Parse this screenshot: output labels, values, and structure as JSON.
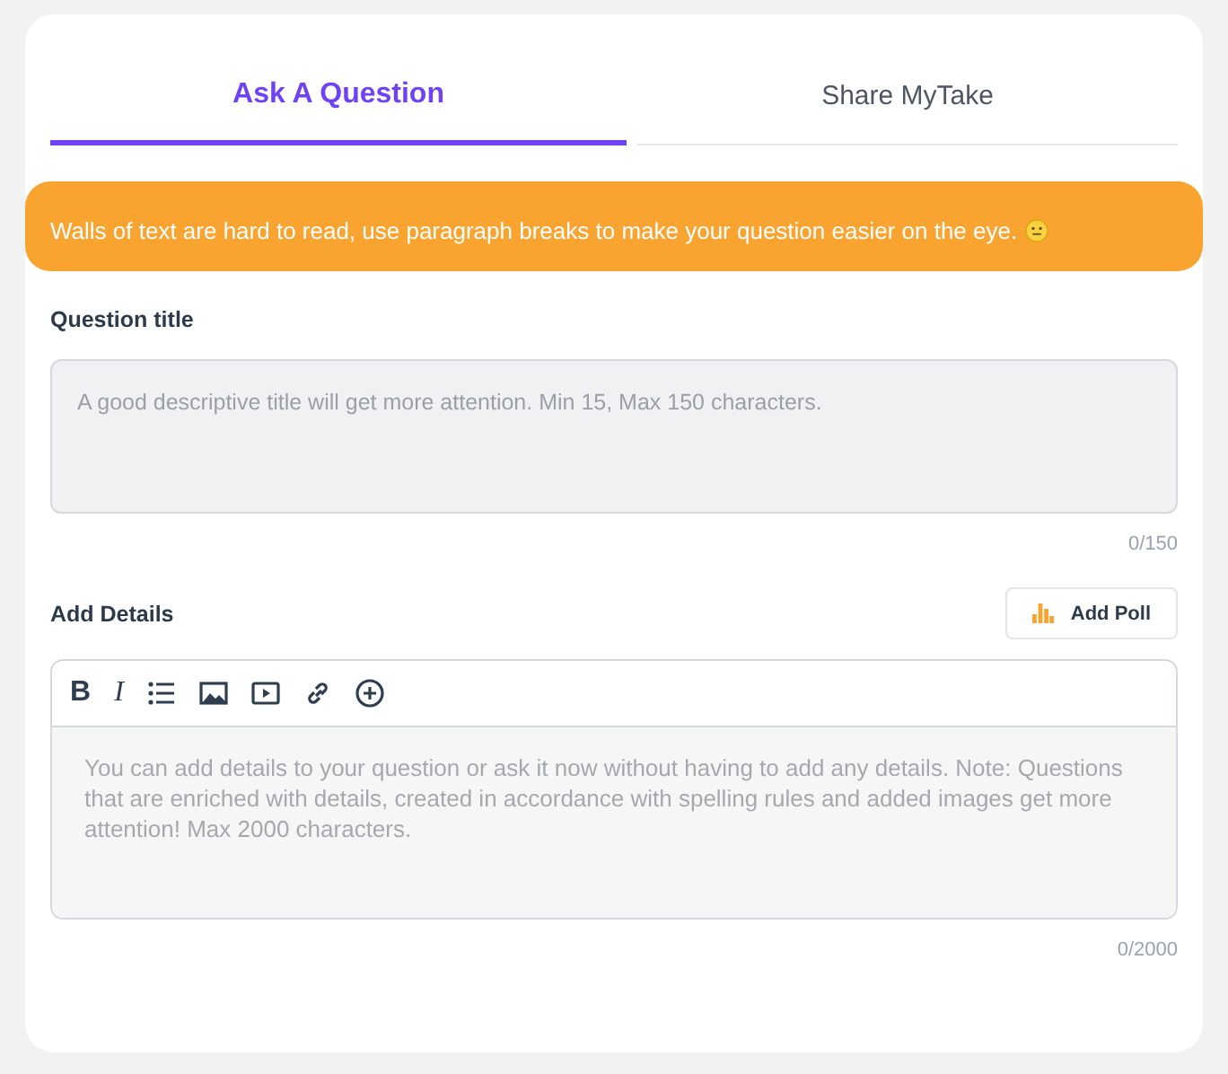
{
  "tabs": [
    {
      "label": "Ask A Question",
      "selected": true
    },
    {
      "label": "Share MyTake",
      "selected": false
    }
  ],
  "banner": {
    "text": "Walls of text are hard to read, use paragraph breaks to make your question easier on the eye."
  },
  "question_title": {
    "label": "Question title",
    "placeholder": "A good descriptive title will get more attention. Min 15, Max 150 characters.",
    "counter": "0/150"
  },
  "details": {
    "label": "Add Details",
    "add_poll_button": "Add Poll",
    "toolbar": [
      {
        "kind": "bold",
        "label": "B"
      },
      {
        "kind": "italic",
        "label": "I"
      },
      {
        "kind": "list"
      },
      {
        "kind": "image"
      },
      {
        "kind": "video"
      },
      {
        "kind": "link"
      },
      {
        "kind": "plus"
      }
    ],
    "placeholder": "You can add details to your question or ask it now without having to add any details. Note: Questions that are enriched with details, created in accordance with spelling rules and added images get more attention! Max 2000 characters.",
    "counter": "0/2000"
  }
}
